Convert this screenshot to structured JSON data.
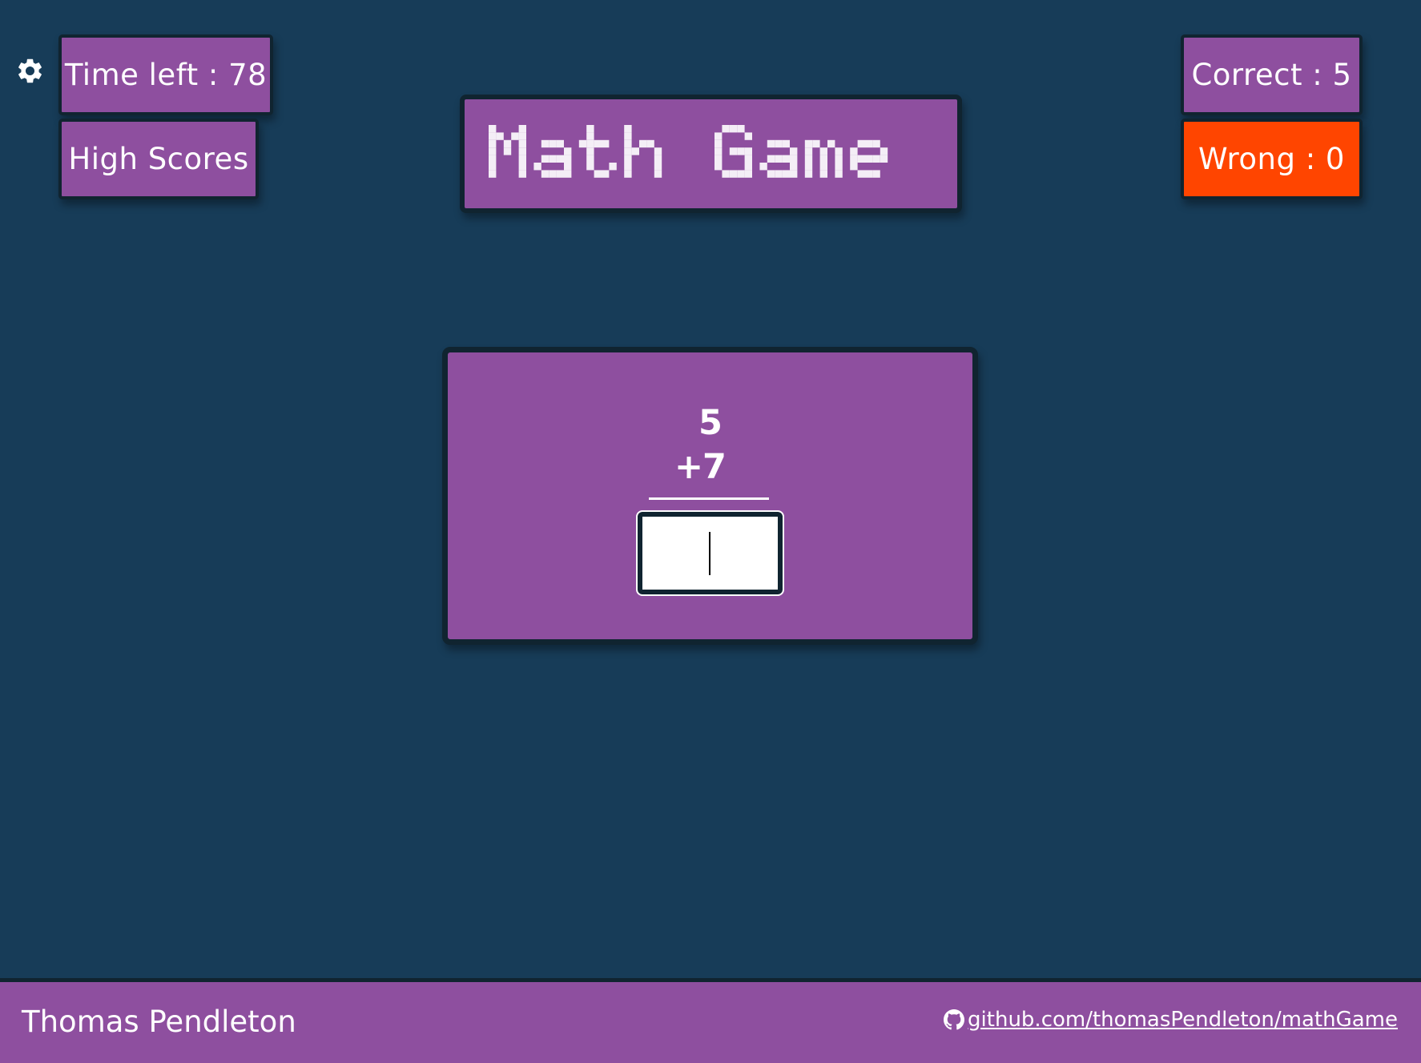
{
  "stats": {
    "time_left": "Time left : 78",
    "high_scores": "High Scores",
    "correct": "Correct : 5",
    "wrong": "Wrong : 0"
  },
  "title": "Math Game",
  "problem": {
    "operand_a": "5",
    "operator": "+",
    "operand_b": "7",
    "answer_value": ""
  },
  "footer": {
    "author": "Thomas Pendleton",
    "repo_link": "github.com/thomasPendleton/mathGame"
  },
  "icons": {
    "settings": "gear-icon",
    "github": "github-icon"
  },
  "colors": {
    "background": "#173c58",
    "panel": "#8e4f9f",
    "wrong": "#ff4500",
    "border": "#102430"
  }
}
